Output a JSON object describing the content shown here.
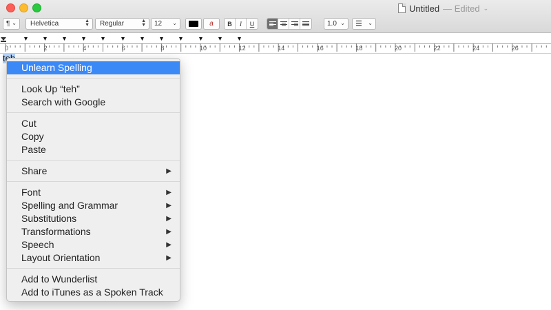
{
  "window": {
    "title": "Untitled",
    "edited": "— Edited",
    "title_chevron": "⌄"
  },
  "toolbar": {
    "paragraph_style": "¶",
    "font_family": "Helvetica",
    "font_style": "Regular",
    "font_size": "12",
    "bold": "B",
    "italic": "I",
    "underline": "U",
    "line_spacing": "1.0",
    "text_color": "#000000",
    "highlight_color_icon": "a"
  },
  "ruler": {
    "labels": [
      "0",
      "2",
      "4",
      "6",
      "8",
      "10",
      "12",
      "14",
      "16",
      "18",
      "20",
      "22",
      "24",
      "26"
    ]
  },
  "document": {
    "selected_word": "teh"
  },
  "context_menu": {
    "groups": [
      [
        {
          "label": "Unlearn Spelling",
          "highlighted": true,
          "submenu": false
        }
      ],
      [
        {
          "label": "Look Up “teh”",
          "submenu": false
        },
        {
          "label": "Search with Google",
          "submenu": false
        }
      ],
      [
        {
          "label": "Cut",
          "submenu": false
        },
        {
          "label": "Copy",
          "submenu": false
        },
        {
          "label": "Paste",
          "submenu": false
        }
      ],
      [
        {
          "label": "Share",
          "submenu": true
        }
      ],
      [
        {
          "label": "Font",
          "submenu": true
        },
        {
          "label": "Spelling and Grammar",
          "submenu": true
        },
        {
          "label": "Substitutions",
          "submenu": true
        },
        {
          "label": "Transformations",
          "submenu": true
        },
        {
          "label": "Speech",
          "submenu": true
        },
        {
          "label": "Layout Orientation",
          "submenu": true
        }
      ],
      [
        {
          "label": "Add to Wunderlist",
          "submenu": false
        },
        {
          "label": "Add to iTunes as a Spoken Track",
          "submenu": false
        }
      ]
    ],
    "submenu_arrow": "▶"
  }
}
